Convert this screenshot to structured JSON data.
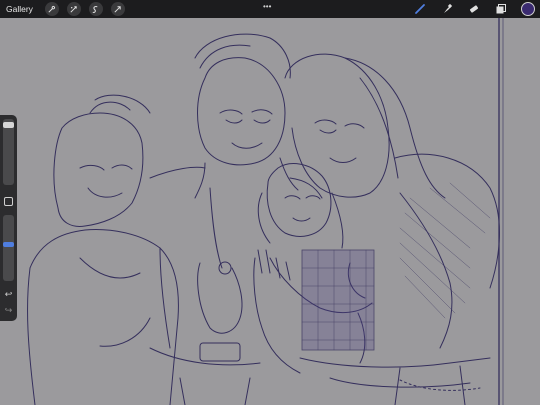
{
  "toolbar": {
    "gallery_label": "Gallery",
    "left_tools": [
      "wrench-icon",
      "adjustments-icon",
      "selection-icon",
      "transform-icon"
    ],
    "more_label": "•••",
    "right_tools": [
      "brush-icon",
      "smudge-icon",
      "eraser-icon",
      "layers-icon"
    ],
    "active_color": "#3a2a70"
  },
  "sidebar": {
    "brush_size_level": 0.05,
    "opacity_level": 0.45,
    "undo_icon": "↩",
    "redo_icon": "↪"
  },
  "colors": {
    "canvas": "#9b9a9d",
    "stroke": "#2a2456",
    "toolbar": "#1c1c1e",
    "accent_brush": "#4f7ee0"
  }
}
